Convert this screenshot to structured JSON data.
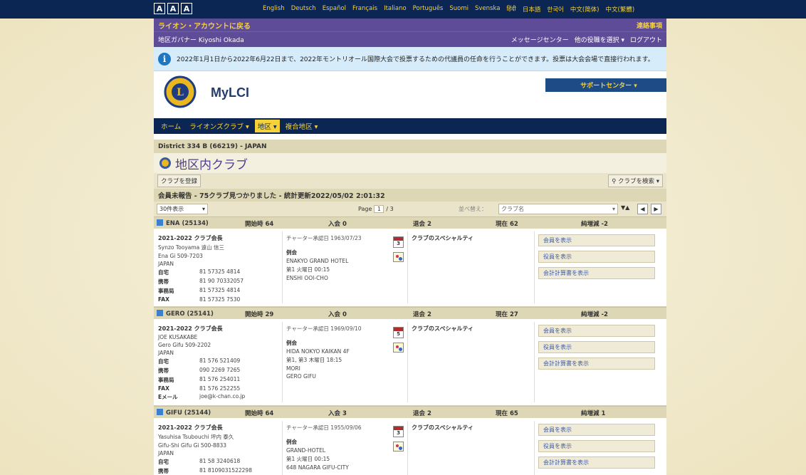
{
  "font_sizes": [
    "A",
    "A",
    "A"
  ],
  "languages": [
    "English",
    "Deutsch",
    "Español",
    "Français",
    "Italiano",
    "Português",
    "Suomi",
    "Svenska",
    "हिंदी",
    "日本語",
    "한국어",
    "中文(简体)",
    "中文(繁體)"
  ],
  "top": {
    "back_link": "ライオン・アカウントに戻る",
    "contact": "連絡事項"
  },
  "gov_bar": {
    "name": "地区ガバナー Kiyoshi Okada",
    "nav": [
      "メッセージセンター",
      "他の役職を選択 ▾",
      "ログアウト"
    ]
  },
  "info_text": "2022年1月1日から2022年6月22日まで、2022年モントリオール国際大会で投票するための代議員の任命を行うことができます。投票は大会会場で直接行われます。",
  "brand": "MyLCI",
  "support_button": "サポートセンター ▾",
  "main_nav": [
    "ホーム",
    "ライオンズクラブ ▾",
    "地区 ▾",
    "複合地区 ▾"
  ],
  "breadcrumb": "District 334 B (66219) - JAPAN",
  "page_title": "地区内クラブ",
  "toolbar": {
    "register": "クラブを登録",
    "search": "クラブを検索 ▾"
  },
  "summary": "会員未報告 - 75クラブ見つかりました - 統計更新2022/05/02 2:01:32",
  "pager": {
    "per_page": "30件表示",
    "page_prefix": "Page",
    "page_value": "1",
    "page_total": "/ 3",
    "sort_label": "並べ替え：",
    "sort_value": "クラブ名",
    "sort_arrows": "▼▲"
  },
  "clubs": [
    {
      "head": {
        "name": "ENA  (25134)",
        "start": "開始時 64",
        "joined": "入会 0",
        "left": "退会 2",
        "current": "現在 62",
        "net": "純増減 -2"
      },
      "president_title": "2021-2022 クラブ会長",
      "president_lines": [
        "Synzo Tooyama 遠山 信三",
        "Ena Gi 509-7203",
        "JAPAN"
      ],
      "contacts": [
        [
          "自宅",
          "81 57325 4814"
        ],
        [
          "携帯",
          "81 90 70332057"
        ],
        [
          "事務局",
          "81 57325 4814"
        ],
        [
          "FAX",
          "81 57325 7530"
        ]
      ],
      "charter": "チャーター承認日 1963/07/23",
      "meeting_label": "例会",
      "meeting_lines": [
        "ENAKYO GRAND HOTEL",
        "第1 火曜日 00:15",
        "ENSHI OOI-CHO"
      ],
      "cal_num": "3",
      "specialty": "クラブのスペシャルティ",
      "actions": [
        "会員を表示",
        "役員を表示",
        "会計計算書を表示"
      ]
    },
    {
      "head": {
        "name": "GERO  (25141)",
        "start": "開始時 29",
        "joined": "入会 0",
        "left": "退会 2",
        "current": "現在 27",
        "net": "純増減 -2"
      },
      "president_title": "2021-2022 クラブ会長",
      "president_lines": [
        "JOE KUSAKABE",
        "Gero Gifu 509-2202",
        "JAPAN"
      ],
      "contacts": [
        [
          "自宅",
          "81 576 521409"
        ],
        [
          "携帯",
          "090 2269 7265"
        ],
        [
          "事務局",
          "81 576 254011"
        ],
        [
          "FAX",
          "81 576 252255"
        ],
        [
          "Eメール",
          "joe@k-chan.co.jp"
        ]
      ],
      "charter": "チャーター承認日 1969/09/10",
      "meeting_label": "例会",
      "meeting_lines": [
        "HIDA NOKYO KAIKAN 4F",
        "第1, 第3 木曜日 18:15",
        "MORI",
        "GERO GIFU"
      ],
      "cal_num": "5",
      "specialty": "クラブのスペシャルティ",
      "actions": [
        "会員を表示",
        "役員を表示",
        "会計計算書を表示"
      ]
    },
    {
      "head": {
        "name": "GIFU  (25144)",
        "start": "開始時 64",
        "joined": "入会 3",
        "left": "退会 2",
        "current": "現在 65",
        "net": "純増減 1"
      },
      "president_title": "2021-2022 クラブ会長",
      "president_lines": [
        "Yasuhisa Tsubouchi 坪内 泰久",
        "Gifu-Shi Gifu Gi 500-8833",
        "JAPAN"
      ],
      "contacts": [
        [
          "自宅",
          "81 58 3240618"
        ],
        [
          "携帯",
          "81 8109031522298"
        ]
      ],
      "charter": "チャーター承認日 1955/09/06",
      "meeting_label": "例会",
      "meeting_lines": [
        "GRAND-HOTEL",
        "第1 火曜日 00:15",
        "648 NAGARA  GIFU-CITY"
      ],
      "cal_num": "3",
      "specialty": "クラブのスペシャルティ",
      "actions": [
        "会員を表示",
        "役員を表示",
        "会計計算書を表示"
      ]
    }
  ]
}
